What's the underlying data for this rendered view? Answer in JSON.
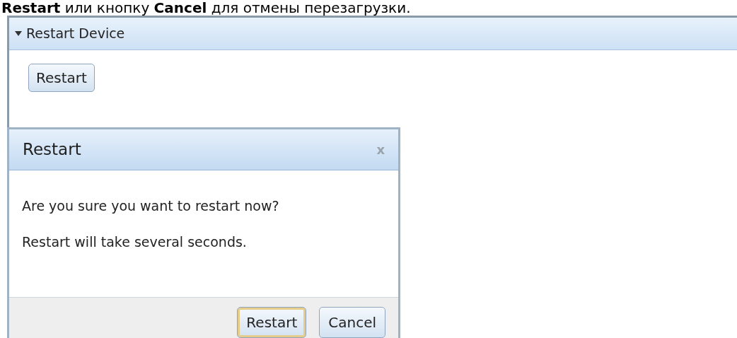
{
  "intro": "**Restart** или кнопку **Cancel** для отмены перезагрузки.",
  "panel": {
    "title": "Restart Device",
    "expanded": true,
    "button": "Restart"
  },
  "dialog": {
    "title": "Restart",
    "close": "x",
    "lines": [
      "Are you sure you want to restart now?",
      "Restart will take several seconds."
    ],
    "buttons": [
      {
        "label": "Restart",
        "focused": true
      },
      {
        "label": "Cancel",
        "focused": false
      }
    ]
  }
}
